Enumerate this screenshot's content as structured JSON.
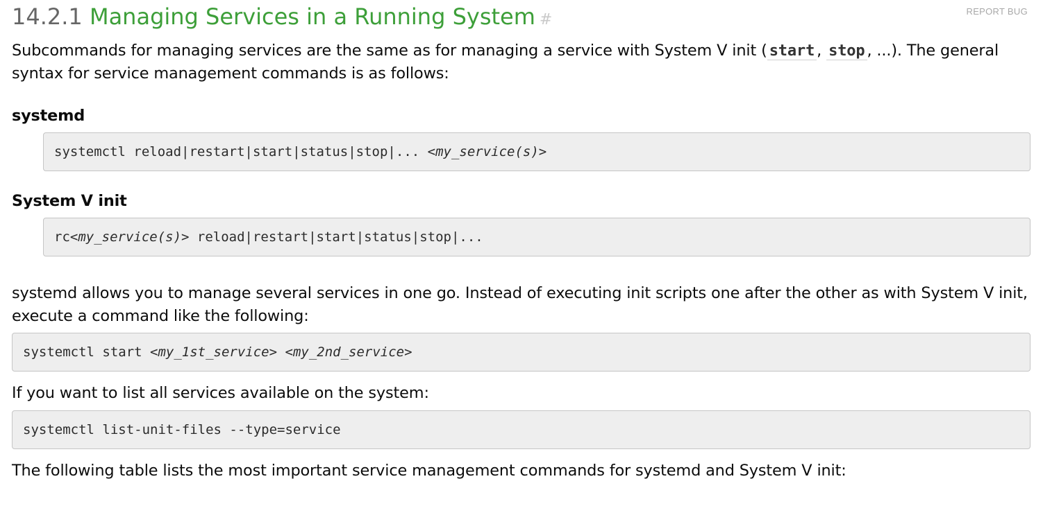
{
  "header": {
    "report_bug": "REPORT BUG",
    "section_number": "14.2.1",
    "section_title": "Managing Services in a Running System",
    "anchor": "#"
  },
  "intro": {
    "text_before": "Subcommands for managing services are the same as for managing a service with System V init (",
    "code_start": "start",
    "separator": ",",
    "code_stop": "stop",
    "text_after": ", ...). The general",
    "line2": "syntax for service management commands is as follows:"
  },
  "systemd_block": {
    "heading": "systemd",
    "command": "systemctl reload|restart|start|status|stop|... ",
    "argument": "<my_service(s)>"
  },
  "sysv_block": {
    "heading": "System V init",
    "command_prefix": "rc",
    "argument": "<my_service(s)>",
    "command_suffix": " reload|restart|start|status|stop|..."
  },
  "multi": {
    "line1": "systemd allows you to manage several services in one go. Instead of executing init scripts one after the other as with System V init,",
    "line2": "execute a command like the following:",
    "command": "systemctl start ",
    "arg1": "<my_1st_service>",
    "space": " ",
    "arg2": "<my_2nd_service>"
  },
  "list": {
    "text": "If you want to list all services available on the system:",
    "command": "systemctl list-unit-files --type=service"
  },
  "table_intro": {
    "text": "The following table lists the most important service management commands for systemd and System V init:"
  },
  "colors": {
    "title_green": "#3d9f39",
    "number_gray": "#666666",
    "code_background": "#eeeeee",
    "code_border": "#c5c5c5"
  }
}
